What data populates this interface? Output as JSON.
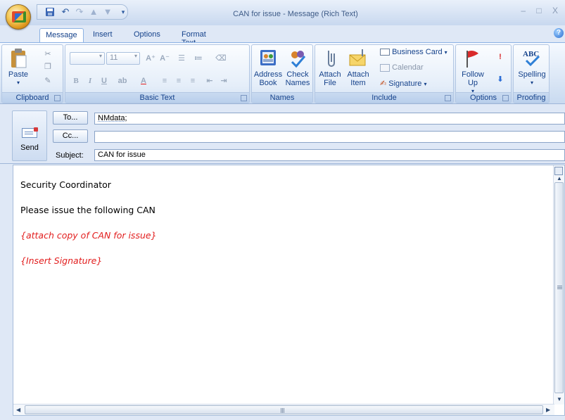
{
  "window": {
    "title": "CAN for issue - Message (Rich Text)",
    "controls": "– □ X"
  },
  "tabs": [
    {
      "label": "Message",
      "active": true
    },
    {
      "label": "Insert",
      "active": false
    },
    {
      "label": "Options",
      "active": false
    },
    {
      "label": "Format Text",
      "active": false
    }
  ],
  "ribbon": {
    "clipboard": {
      "label": "Clipboard",
      "paste": "Paste"
    },
    "basic_text": {
      "label": "Basic Text",
      "font_size": "11"
    },
    "names": {
      "label": "Names",
      "address_book": "Address Book",
      "check_names": "Check Names"
    },
    "include": {
      "label": "Include",
      "attach_file": "Attach File",
      "attach_item": "Attach Item",
      "business_card": "Business Card",
      "calendar": "Calendar",
      "signature": "Signature"
    },
    "options": {
      "label": "Options",
      "follow_up": "Follow Up"
    },
    "proofing": {
      "label": "Proofing",
      "spelling": "Spelling"
    }
  },
  "header": {
    "send": "Send",
    "to_button": "To...",
    "cc_button": "Cc...",
    "subject_label": "Subject:",
    "to_value": "NMdata;",
    "cc_value": "",
    "subject_value": "CAN for issue"
  },
  "body": {
    "lines": [
      {
        "text": "Security Coordinator",
        "style": "normal"
      },
      {
        "text": "Please issue the following CAN",
        "style": "normal"
      },
      {
        "text": "{attach copy of CAN for issue}",
        "style": "red"
      },
      {
        "text": "{Insert Signature}",
        "style": "red"
      }
    ]
  },
  "colors": {
    "accent": "#15428b",
    "placeholder_red": "#e21d1d",
    "chrome": "#dfe8f6"
  }
}
